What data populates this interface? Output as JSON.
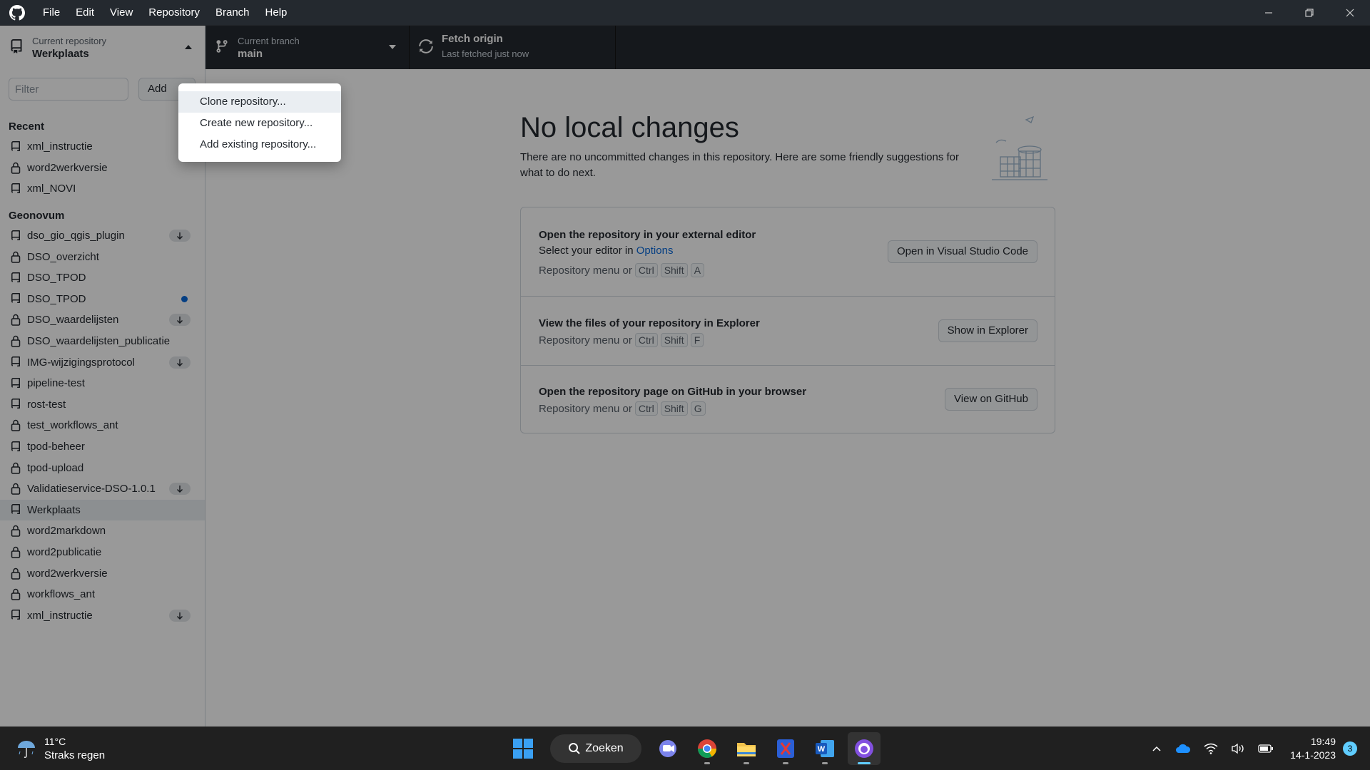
{
  "menu": [
    "File",
    "Edit",
    "View",
    "Repository",
    "Branch",
    "Help"
  ],
  "toolbar": {
    "repo_label": "Current repository",
    "repo_name": "Werkplaats",
    "branch_label": "Current branch",
    "branch_name": "main",
    "fetch_title": "Fetch origin",
    "fetch_status": "Last fetched just now"
  },
  "sidebar": {
    "filter_placeholder": "Filter",
    "add_label": "Add",
    "groups": [
      {
        "title": "Recent",
        "items": [
          {
            "name": "xml_instructie",
            "icon": "repo-icon"
          },
          {
            "name": "word2werkversie",
            "icon": "lock-icon"
          },
          {
            "name": "xml_NOVI",
            "icon": "repo-icon"
          }
        ]
      },
      {
        "title": "Geonovum",
        "items": [
          {
            "name": "dso_gio_qgis_plugin",
            "icon": "repo-icon",
            "badge": "pull"
          },
          {
            "name": "DSO_overzicht",
            "icon": "lock-icon"
          },
          {
            "name": "DSO_TPOD",
            "icon": "repo-icon"
          },
          {
            "name": "DSO_TPOD",
            "icon": "repo-icon",
            "badge": "changes"
          },
          {
            "name": "DSO_waardelijsten",
            "icon": "lock-icon",
            "badge": "pull"
          },
          {
            "name": "DSO_waardelijsten_publicatie",
            "icon": "lock-icon"
          },
          {
            "name": "IMG-wijzigingsprotocol",
            "icon": "repo-icon",
            "badge": "pull"
          },
          {
            "name": "pipeline-test",
            "icon": "repo-icon"
          },
          {
            "name": "rost-test",
            "icon": "repo-icon"
          },
          {
            "name": "test_workflows_ant",
            "icon": "lock-icon"
          },
          {
            "name": "tpod-beheer",
            "icon": "repo-icon"
          },
          {
            "name": "tpod-upload",
            "icon": "lock-icon"
          },
          {
            "name": "Validatieservice-DSO-1.0.1",
            "icon": "lock-icon",
            "badge": "pull"
          },
          {
            "name": "Werkplaats",
            "icon": "repo-icon",
            "selected": true
          },
          {
            "name": "word2markdown",
            "icon": "lock-icon"
          },
          {
            "name": "word2publicatie",
            "icon": "lock-icon"
          },
          {
            "name": "word2werkversie",
            "icon": "lock-icon"
          },
          {
            "name": "workflows_ant",
            "icon": "lock-icon"
          },
          {
            "name": "xml_instructie",
            "icon": "repo-icon",
            "badge": "pull"
          }
        ]
      }
    ]
  },
  "dropdown": {
    "items": [
      "Clone repository...",
      "Create new repository...",
      "Add existing repository..."
    ]
  },
  "main": {
    "heading": "No local changes",
    "subtext": "There are no uncommitted changes in this repository. Here are some friendly suggestions for what to do next.",
    "suggestions": [
      {
        "title": "Open the repository in your external editor",
        "line_prefix": "Select your editor in ",
        "line_link": "Options",
        "keys_prefix": "Repository menu or",
        "keys": [
          "Ctrl",
          "Shift",
          "A"
        ],
        "button": "Open in Visual Studio Code"
      },
      {
        "title": "View the files of your repository in Explorer",
        "keys_prefix": "Repository menu or",
        "keys": [
          "Ctrl",
          "Shift",
          "F"
        ],
        "button": "Show in Explorer"
      },
      {
        "title": "Open the repository page on GitHub in your browser",
        "keys_prefix": "Repository menu or",
        "keys": [
          "Ctrl",
          "Shift",
          "G"
        ],
        "button": "View on GitHub"
      }
    ]
  },
  "taskbar": {
    "temperature": "11°C",
    "weather": "Straks regen",
    "search": "Zoeken",
    "time": "19:49",
    "date": "14-1-2023",
    "notifications": "3"
  },
  "colors": {
    "accent": "#0969da",
    "titlebar": "#24292f",
    "taskbar": "#202020"
  }
}
